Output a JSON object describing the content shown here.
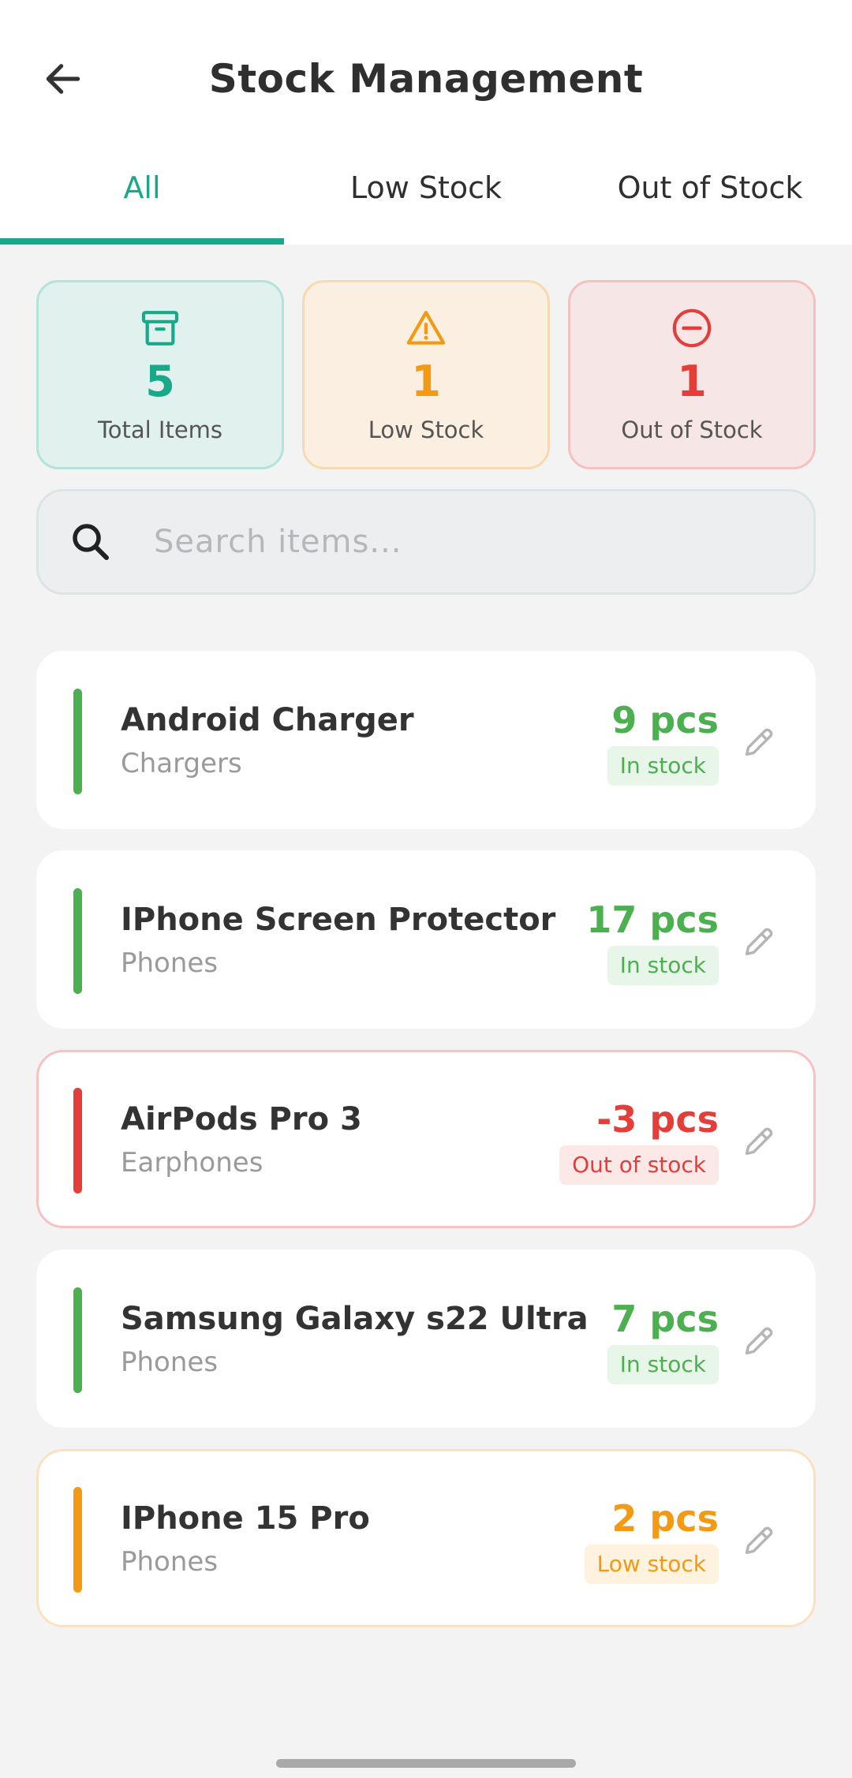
{
  "header": {
    "title": "Stock Management",
    "back_icon": "arrow-left-icon"
  },
  "tabs": [
    {
      "label": "All",
      "active": true
    },
    {
      "label": "Low Stock",
      "active": false
    },
    {
      "label": "Out of Stock",
      "active": false
    }
  ],
  "stats": {
    "total": {
      "icon": "archive-box-icon",
      "value": "5",
      "label": "Total Items",
      "color": "#1aa88a"
    },
    "low": {
      "icon": "warning-triangle-icon",
      "value": "1",
      "label": "Low Stock",
      "color": "#f29a14"
    },
    "out": {
      "icon": "minus-circle-icon",
      "value": "1",
      "label": "Out of Stock",
      "color": "#e33e3a"
    }
  },
  "search": {
    "placeholder": "Search items...",
    "value": ""
  },
  "status_colors": {
    "in_stock": {
      "fg": "#4caf50",
      "bg": "#e8f5e9"
    },
    "out_of_stock": {
      "fg": "#e33e3a",
      "bg": "#fde8e8"
    },
    "low_stock": {
      "fg": "#f29a14",
      "bg": "#fff3e0"
    }
  },
  "items": [
    {
      "name": "Android Charger",
      "category": "Chargers",
      "quantity": "9 pcs",
      "status": "In stock",
      "status_key": "in_stock"
    },
    {
      "name": "IPhone Screen Protector",
      "category": "Phones",
      "quantity": "17 pcs",
      "status": "In stock",
      "status_key": "in_stock"
    },
    {
      "name": "AirPods Pro 3",
      "category": "Earphones",
      "quantity": "-3 pcs",
      "status": "Out of stock",
      "status_key": "out_of_stock"
    },
    {
      "name": "Samsung Galaxy s22 Ultra",
      "category": "Phones",
      "quantity": "7 pcs",
      "status": "In stock",
      "status_key": "in_stock"
    },
    {
      "name": "IPhone 15 Pro",
      "category": "Phones",
      "quantity": "2 pcs",
      "status": "Low stock",
      "status_key": "low_stock"
    }
  ]
}
